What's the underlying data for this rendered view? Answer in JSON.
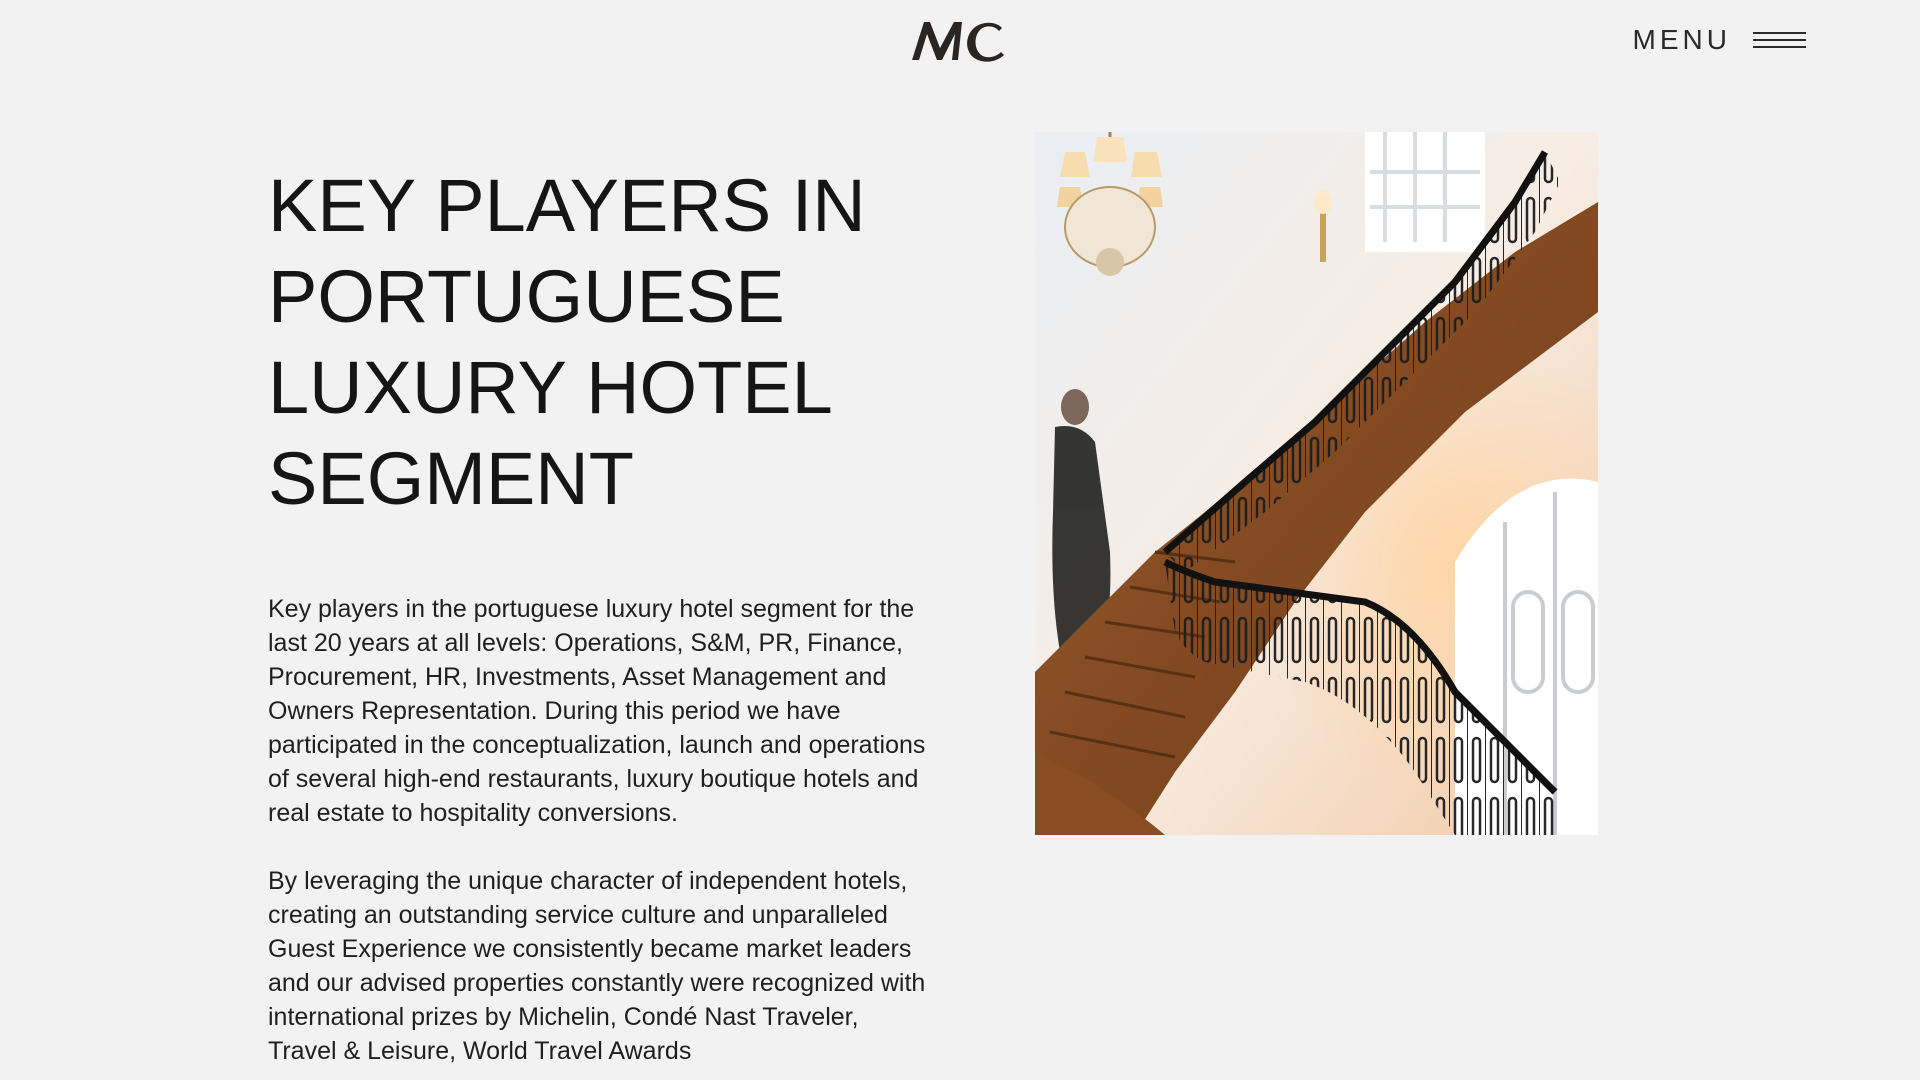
{
  "header": {
    "logo_text": "MC",
    "menu_label": "MENU",
    "menu_icon": "hamburger-icon"
  },
  "main": {
    "title_lines": [
      "KEY PLAYERS IN",
      "PORTUGUESE",
      "LUXURY HOTEL",
      "SEGMENT"
    ],
    "paragraphs": [
      "Key players in the portuguese luxury hotel segment for the last 20 years at all levels: Operations, S&M, PR, Finance, Procurement, HR, Investments, Asset Management and Owners Representation. During this period we have participated in the conceptualization, launch and operations of several high-end restaurants, luxury boutique hotels and real estate to hospitality conversions.",
      "By leveraging the unique character of independent hotels, creating an outstanding service culture and unparalleled Guest Experience we consistently became market leaders and our advised properties constantly were recognized with international prizes by Michelin, Condé Nast Traveler, Travel & Leisure, World Travel Awards"
    ]
  },
  "image": {
    "subject": "staircase-with-wrought-iron-railing-and-chandelier"
  },
  "colors": {
    "background": "#f2f2f2",
    "text": "#1a1a1a"
  }
}
